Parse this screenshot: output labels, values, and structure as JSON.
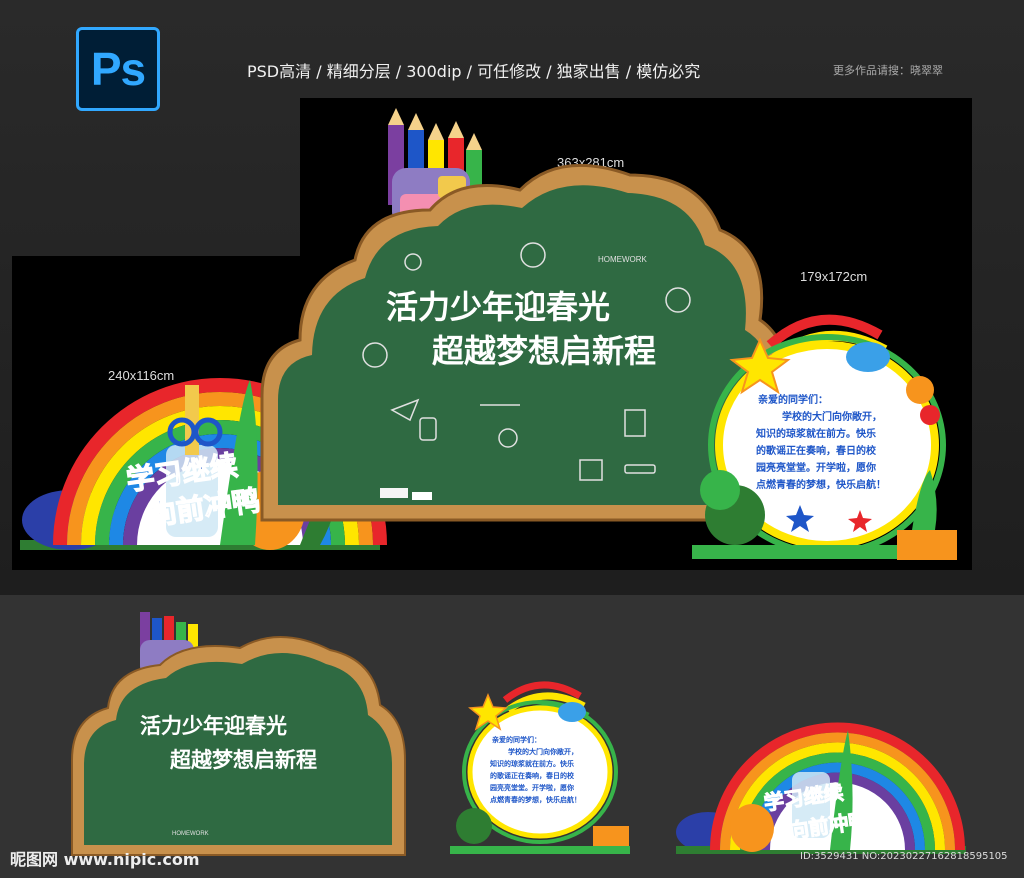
{
  "header": {
    "logo_text": "Ps",
    "features": "PSD高清  / 精细分层 / 300dip / 可任修改 / 独家出售 / 模仿必究",
    "more": "更多作品请搜：晓翠翠"
  },
  "dimensions": {
    "main": "363x281cm",
    "right": "179x172cm",
    "left": "240x116cm"
  },
  "board": {
    "title_line1": "活力少年迎春光",
    "title_line2": "超越梦想启新程",
    "homework": "HOMEWORK"
  },
  "left_panel": {
    "line1": "学习继续",
    "line2": "向前冲鸭"
  },
  "right_panel": {
    "line1": "亲爱的同学们：",
    "line2": "学校的大门向你敞开，",
    "line3": "知识的琼浆就在前方。快乐",
    "line4": "的歌谣正在奏响，春日的校",
    "line5": "园亮亮堂堂。开学啦，愿你",
    "line6": "点燃青春的梦想，快乐启航！"
  },
  "footer": {
    "watermark": "昵图网 www.nipic.com",
    "id": "ID:3529431 NO:20230227162818595105"
  },
  "colors": {
    "board_green": "#2f6a42",
    "frame_wood": "#c8914c",
    "rainbow": [
      "#e8262b",
      "#f7941d",
      "#ffe600",
      "#37b44a",
      "#1e88e5",
      "#6a3fa0"
    ]
  }
}
